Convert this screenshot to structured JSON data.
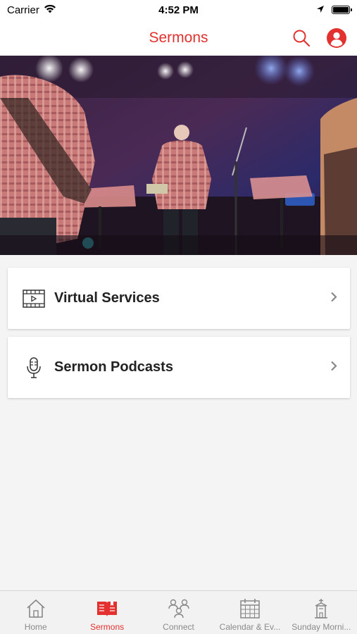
{
  "status_bar": {
    "carrier": "Carrier",
    "time": "4:52 PM"
  },
  "header": {
    "title": "Sermons",
    "search_icon": "search-icon",
    "account_icon": "user-icon"
  },
  "colors": {
    "accent": "#e2312e",
    "background": "#f4f4f5",
    "tab_inactive": "#8a8a8a"
  },
  "cards": [
    {
      "label": "Virtual Services",
      "icon": "video-icon"
    },
    {
      "label": "Sermon Podcasts",
      "icon": "microphone-icon"
    }
  ],
  "tabs": [
    {
      "label": "Home",
      "icon": "home-icon",
      "active": false
    },
    {
      "label": "Sermons",
      "icon": "book-icon",
      "active": true
    },
    {
      "label": "Connect",
      "icon": "people-icon",
      "active": false
    },
    {
      "label": "Calendar & Ev...",
      "icon": "calendar-icon",
      "active": false
    },
    {
      "label": "Sunday Morni...",
      "icon": "church-icon",
      "active": false
    }
  ]
}
